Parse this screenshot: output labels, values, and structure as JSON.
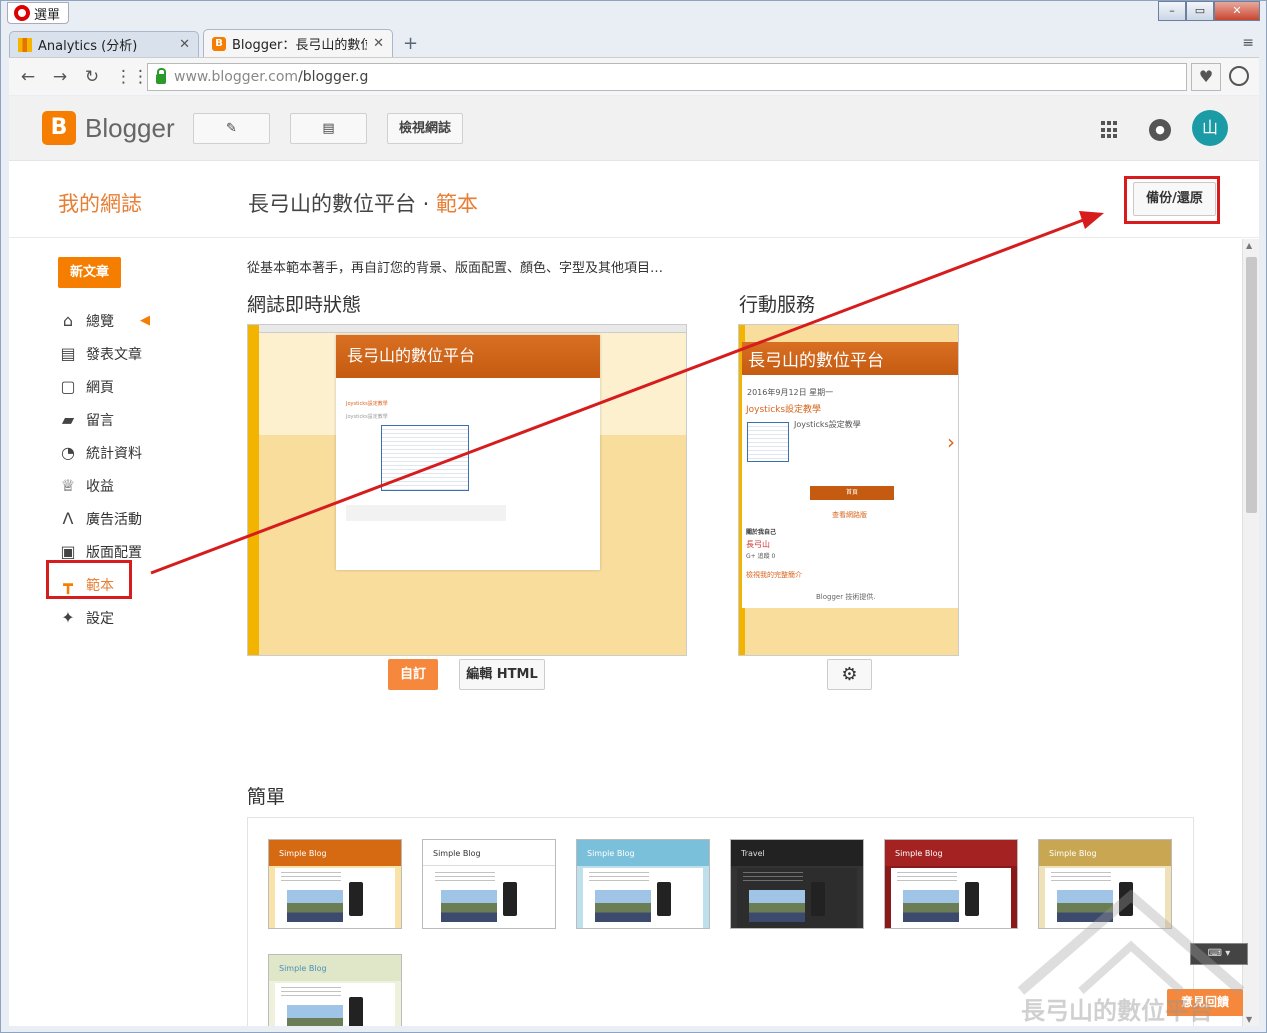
{
  "browser": {
    "menu_label": "選單",
    "tabs": [
      {
        "title": "Analytics (分析)",
        "icon": "analytics-favicon"
      },
      {
        "title": "Blogger：長弓山的數位平",
        "icon": "blogger-favicon"
      }
    ],
    "url_domain": "www.blogger.com",
    "url_path": "/blogger.g"
  },
  "header": {
    "logo_text": "Blogger",
    "view_blog_label": "檢視網誌",
    "avatar_text": "山"
  },
  "subheader": {
    "my_blogs": "我的網誌",
    "blog_name": "長弓山的數位平台",
    "separator": " · ",
    "current_page": "範本",
    "backup_label": "備份/還原"
  },
  "sidebar": {
    "new_post_label": "新文章",
    "items": [
      {
        "label": "總覽",
        "icon": "home-icon"
      },
      {
        "label": "發表文章",
        "icon": "posts-icon"
      },
      {
        "label": "網頁",
        "icon": "pages-icon"
      },
      {
        "label": "留言",
        "icon": "comments-icon"
      },
      {
        "label": "統計資料",
        "icon": "stats-icon"
      },
      {
        "label": "收益",
        "icon": "trophy-icon"
      },
      {
        "label": "廣告活動",
        "icon": "adwords-icon"
      },
      {
        "label": "版面配置",
        "icon": "layout-icon"
      },
      {
        "label": "範本",
        "icon": "theme-icon"
      },
      {
        "label": "設定",
        "icon": "wrench-icon"
      }
    ]
  },
  "main": {
    "intro": "從基本範本著手，再自訂您的背景、版面配置、顏色、字型及其他項目…",
    "live_title": "網誌即時狀態",
    "mobile_title": "行動服務",
    "customize_label": "自訂",
    "edit_html_label": "編輯 HTML",
    "simple_title": "簡單",
    "live_preview": {
      "blog_title": "長弓山的數位平台",
      "post_link": "Joysticks設定教學",
      "post_excerpt": "Joysticks設定教學"
    },
    "mobile_preview": {
      "blog_title": "長弓山的數位平台",
      "date": "2016年9月12日 星期一",
      "post_link": "Joysticks設定教學",
      "excerpt": "Joysticks設定教學",
      "home_label": "首頁",
      "web_version": "查看網路版",
      "about_me": "關於我自己",
      "author": "長弓山",
      "follow": "追蹤",
      "follow_count": "0",
      "profile_link": "檢視我的完整簡介",
      "powered": "Blogger 技術提供."
    },
    "templates": [
      {
        "title": "Simple Blog"
      },
      {
        "title": "Simple Blog"
      },
      {
        "title": "Simple Blog"
      },
      {
        "title": "Travel"
      },
      {
        "title": "Simple Blog"
      },
      {
        "title": "Simple Blog"
      },
      {
        "title": "Simple Blog"
      }
    ]
  },
  "overlay": {
    "feedback_label": "意見回饋",
    "watermark": "長弓山的數位平台",
    "annotation_color": "#d61c1c"
  },
  "colors": {
    "blogger_orange": "#f57d00",
    "accent_text": "#e67e33",
    "avatar_teal": "#1a9ba5"
  }
}
